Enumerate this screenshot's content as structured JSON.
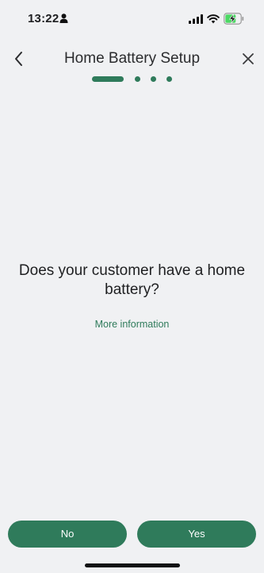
{
  "status_bar": {
    "time": "13:22",
    "icons": [
      "person-icon",
      "signal-icon",
      "wifi-icon",
      "battery-charging-icon"
    ]
  },
  "nav": {
    "title": "Home Battery Setup",
    "back_icon": "chevron-left-icon",
    "close_icon": "close-icon"
  },
  "progress": {
    "total_steps": 4,
    "current_step": 1
  },
  "content": {
    "question": "Does your customer have a home battery?",
    "more_info_link": "More information"
  },
  "actions": {
    "no_label": "No",
    "yes_label": "Yes"
  },
  "colors": {
    "accent": "#2f7b5b",
    "background": "#f0f1f3",
    "text": "#1e1f21",
    "battery_charging": "#4cd964"
  }
}
